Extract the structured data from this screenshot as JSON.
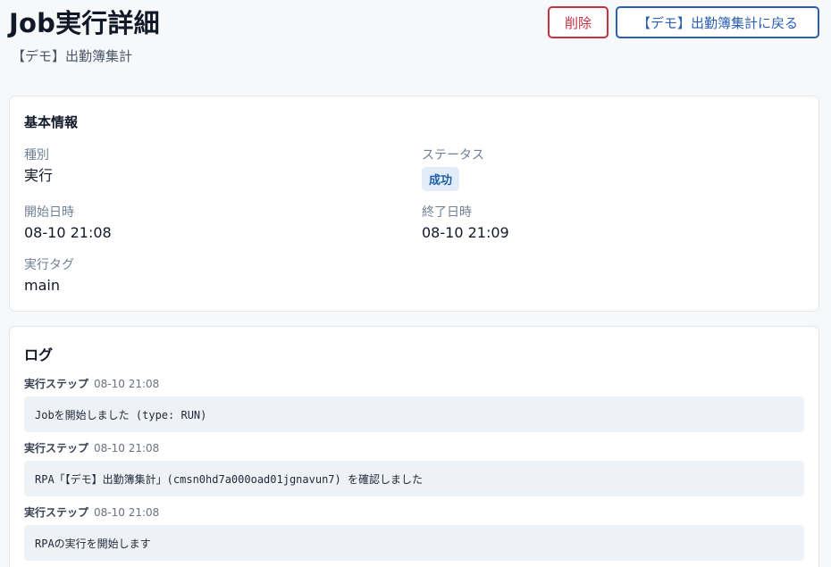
{
  "header": {
    "title": "Job実行詳細",
    "subtitle": "【デモ】出勤簿集計",
    "delete_label": "削除",
    "back_label": "【デモ】出勤簿集計に戻る"
  },
  "info": {
    "title": "基本情報",
    "type_label": "種別",
    "type_value": "実行",
    "status_label": "ステータス",
    "status_value": "成功",
    "start_label": "開始日時",
    "start_value": "08-10 21:08",
    "end_label": "終了日時",
    "end_value": "08-10 21:09",
    "tag_label": "実行タグ",
    "tag_value": "main"
  },
  "log": {
    "title": "ログ",
    "entries": [
      {
        "step": "実行ステップ",
        "time": "08-10 21:08",
        "message": "Jobを開始しました (type: RUN)"
      },
      {
        "step": "実行ステップ",
        "time": "08-10 21:08",
        "message": "RPA「【デモ】出勤簿集計」(cmsn0hd7a000oad01jgnavun7) を確認しました"
      },
      {
        "step": "実行ステップ",
        "time": "08-10 21:08",
        "message": "RPAの実行を開始します"
      }
    ]
  },
  "colors": {
    "danger": "#c53042",
    "primary": "#2b5fb3",
    "status_success_bg": "#e2edf9",
    "status_success_text": "#1f5fa8"
  }
}
